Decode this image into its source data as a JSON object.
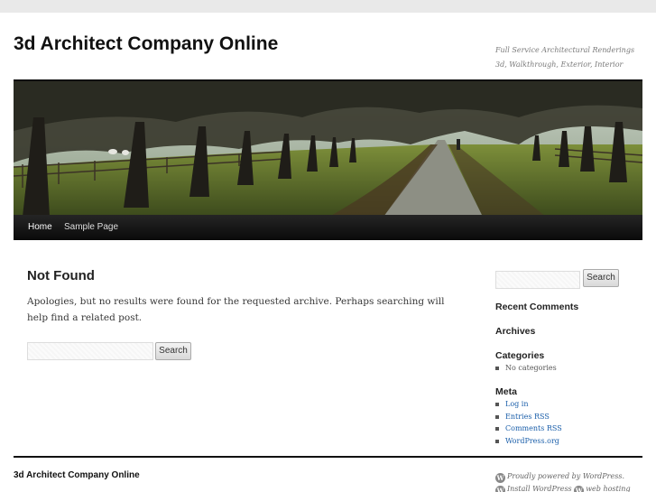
{
  "site": {
    "title": "3d Architect Company Online",
    "description": "Full Service Architectural Renderings 3d, Walkthrough, Exterior, Interior"
  },
  "nav": {
    "items": [
      {
        "label": "Home"
      },
      {
        "label": "Sample Page"
      }
    ]
  },
  "main": {
    "title": "Not Found",
    "text": "Apologies, but no results were found for the requested archive. Perhaps searching will help find a related post.",
    "search_button": "Search"
  },
  "sidebar": {
    "search_button": "Search",
    "recent_comments_title": "Recent Comments",
    "archives_title": "Archives",
    "categories_title": "Categories",
    "categories_items": [
      "No categories"
    ],
    "meta_title": "Meta",
    "meta_items": [
      "Log in",
      "Entries RSS",
      "Comments RSS",
      "WordPress.org"
    ]
  },
  "footer": {
    "title": "3d Architect Company Online",
    "powered": "Proudly powered by WordPress.",
    "install": "Install WordPress",
    "hosting": "web hosting"
  },
  "colors": {
    "link": "#1b5faa",
    "nav_bg": "#111111",
    "page_bg": "#e9e9e9"
  }
}
